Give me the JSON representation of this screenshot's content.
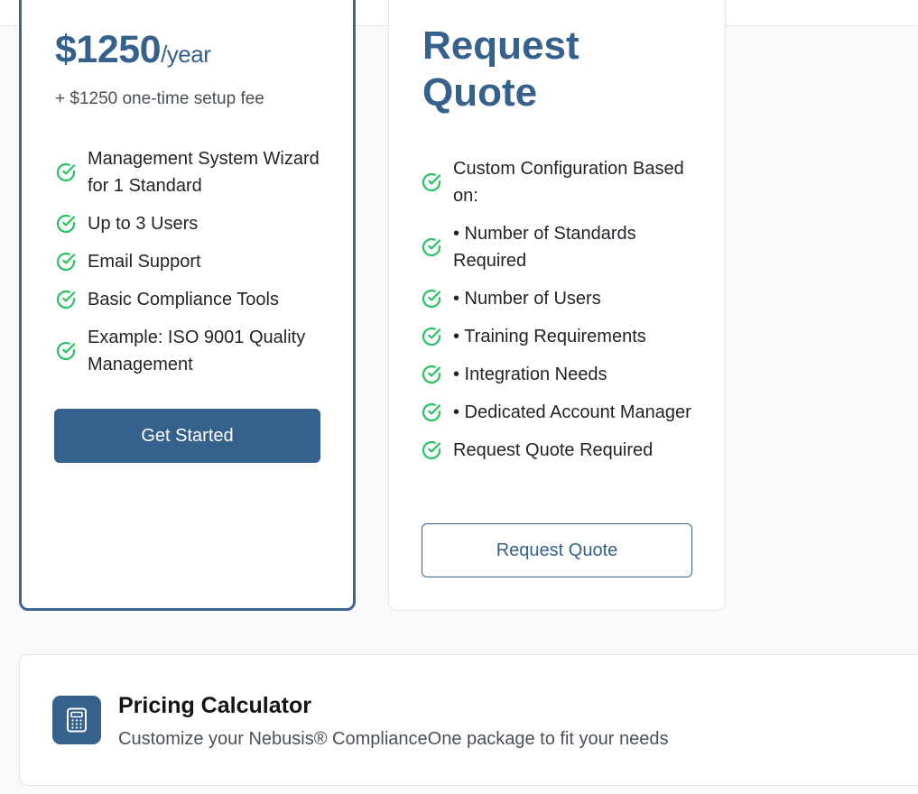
{
  "header": {
    "logo_icon": "nebusis-logo"
  },
  "plans": {
    "basic": {
      "price": "$1250",
      "period": "/year",
      "setup_fee": "+ $1250 one-time setup fee",
      "features": [
        "Management System Wizard for 1 Standard",
        "Up to 3 Users",
        "Email Support",
        "Basic Compliance Tools",
        "Example: ISO 9001 Quality Management"
      ],
      "button_label": "Get Started"
    },
    "custom": {
      "title": "Request Quote",
      "features": [
        "Custom Configuration Based on:",
        "• Number of Standards Required",
        "• Number of Users",
        "• Training Requirements",
        "• Integration Needs",
        "• Dedicated Account Manager",
        "Request Quote Required"
      ],
      "button_label": "Request Quote"
    }
  },
  "calculator": {
    "title": "Pricing Calculator",
    "subtitle": "Customize your Nebusis® ComplianceOne package to fit your needs",
    "icon": "calculator-icon"
  },
  "colors": {
    "brand": "#35618c",
    "check": "#22c55e"
  }
}
